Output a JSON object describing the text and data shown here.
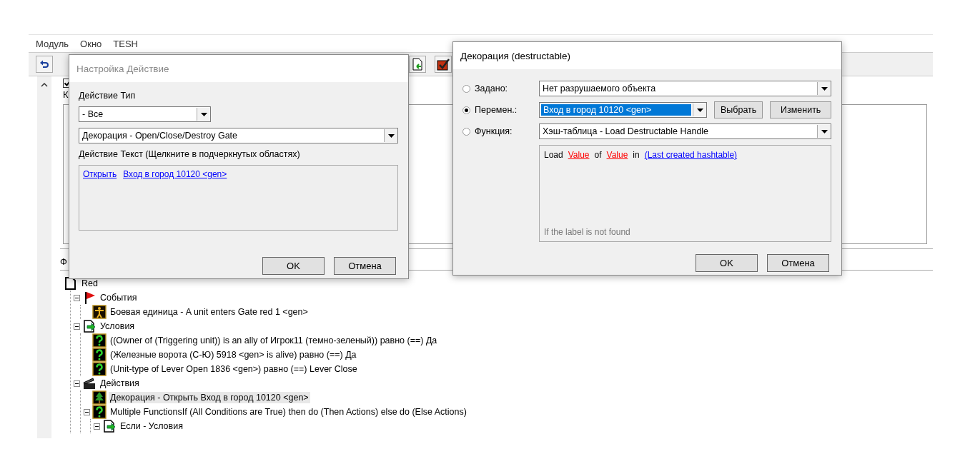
{
  "menu": [
    {
      "label": "Модуль"
    },
    {
      "label": "Окно"
    },
    {
      "label": "TESH"
    }
  ],
  "editor": {
    "enabled_checkbox": {
      "checked": true
    },
    "label_fragment": "К",
    "tab_fragment": "Ф"
  },
  "tree": {
    "label": "Red",
    "kind": "document",
    "selected": false,
    "children": [
      {
        "label": "События",
        "kind": "flag",
        "selected": false,
        "expanded": true,
        "children": [
          {
            "label": "Боевая единица - A unit enters Gate red 1 <gen>",
            "kind": "unit",
            "selected": false
          }
        ]
      },
      {
        "label": "Условия",
        "kind": "conditions",
        "selected": false,
        "expanded": true,
        "children": [
          {
            "label": "((Owner of (Triggering unit)) is an ally of Игрок11 (темно-зеленый)) равно (==) Да",
            "kind": "question",
            "selected": false
          },
          {
            "label": "(Железные ворота (С-Ю) 5918 <gen> is alive) равно (==) Да",
            "kind": "question",
            "selected": false
          },
          {
            "label": "(Unit-type of Lever Open 1836 <gen>) равно (==) Lever Close",
            "kind": "question",
            "selected": false
          }
        ]
      },
      {
        "label": "Действия",
        "kind": "actions",
        "selected": false,
        "expanded": true,
        "children": [
          {
            "label": "Декорация - Открыть Вход в город 10120 <gen>",
            "kind": "tree",
            "selected": true
          },
          {
            "label": "Multiple FunctionsIf (All Conditions are True) then do (Then Actions) else do (Else Actions)",
            "kind": "question",
            "selected": false,
            "expanded": true,
            "children": [
              {
                "label": "Если - Условия",
                "kind": "conditions",
                "selected": false,
                "expanded": true
              }
            ]
          }
        ]
      }
    ]
  },
  "action_dialog": {
    "title": "Настройка Действие",
    "type_label": "Действие Тип",
    "type_value": "- Все",
    "action_value": "Декорация - Open/Close/Destroy Gate",
    "text_label": "Действие Текст (Щелкните в подчеркнутых областях)",
    "text_links": [
      {
        "text": "Открыть"
      },
      {
        "text": "Вход в город 10120 <gen>"
      }
    ],
    "buttons": [
      "OK",
      "Отмена"
    ]
  },
  "destructable_dialog": {
    "title": "Декорация (destructable)",
    "options": [
      {
        "label": "Задано:",
        "selected": false,
        "value": "Нет разрушаемого объекта",
        "highlighted": false
      },
      {
        "label": "Перемен.:",
        "selected": true,
        "value": "Вход в город 10120 <gen>",
        "highlighted": true,
        "buttons": [
          "Выбрать",
          "Изменить"
        ]
      },
      {
        "label": "Функция:",
        "selected": false,
        "value": "Хэш-таблица - Load Destructable Handle",
        "highlighted": false
      }
    ],
    "function_text": [
      {
        "text": "Load",
        "kind": "plain"
      },
      {
        "text": "Value",
        "kind": "missing"
      },
      {
        "text": "of",
        "kind": "plain"
      },
      {
        "text": "Value",
        "kind": "missing"
      },
      {
        "text": "in",
        "kind": "plain"
      },
      {
        "text": "(Last created hashtable)",
        "kind": "link"
      }
    ],
    "hint": "If the label is not found",
    "buttons": [
      "OK",
      "Отмена"
    ]
  }
}
